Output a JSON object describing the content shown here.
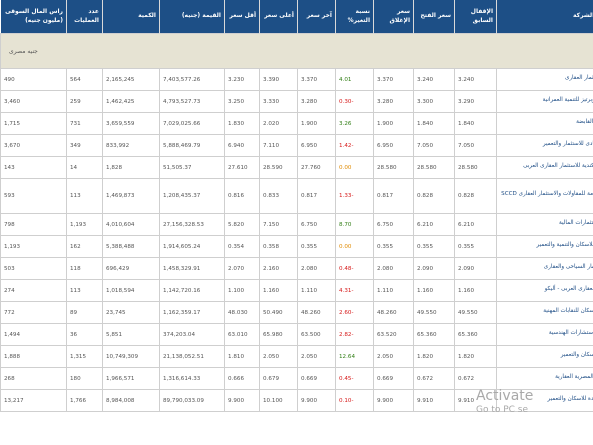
{
  "headers": {
    "name": "اسم الشركة",
    "prev": "الإقفال السابق",
    "close": "سعر الفتح",
    "closing": "سعر الإغلاق",
    "change": "نسبة التغير%",
    "last": "آخر سعر",
    "high": "أعلى سعر",
    "low": "أقل سعر",
    "value": "القيمة (جنيه)",
    "qty": "الكمية",
    "ops": "عدد العمليات",
    "cap": "راس المال السوقى (مليون جنيه)"
  },
  "section": "جنيه مصرى",
  "rows": [
    {
      "name": "تنمية للاستثمار العقارى",
      "prev": "3.240",
      "close": "3.240",
      "closing": "3.370",
      "change": "4.01",
      "dir": "pos",
      "last": "3.370",
      "high": "3.390",
      "low": "3.230",
      "value": "7,403,577.26",
      "qty": "2,165,245",
      "ops": "564",
      "cap": "490"
    },
    {
      "name": "بايونيرز بروبرتيز للتنمية العمرانية",
      "prev": "3.290",
      "close": "3.300",
      "closing": "3.280",
      "change": "-0.30",
      "dir": "neg",
      "last": "3.280",
      "high": "3.330",
      "low": "3.250",
      "value": "4,793,527.73",
      "qty": "1,462,425",
      "ops": "259",
      "cap": "3,460"
    },
    {
      "name": "ايه كابيتال القابضة",
      "prev": "1.840",
      "close": "1.840",
      "closing": "1.900",
      "change": "3.26",
      "dir": "pos",
      "last": "1.900",
      "high": "2.020",
      "low": "1.830",
      "value": "7,029,025.66",
      "qty": "3,659,559",
      "ops": "731",
      "cap": "1,715"
    },
    {
      "name": "زهراء المعادى للاستثمار والتعمير",
      "prev": "7.050",
      "close": "7.050",
      "closing": "6.950",
      "change": "-1.42",
      "dir": "neg",
      "last": "6.950",
      "high": "7.110",
      "low": "6.940",
      "value": "5,888,469.79",
      "qty": "833,992",
      "ops": "349",
      "cap": "3,670"
    },
    {
      "name": "الخليجية الكندية للاستثمار العقارى العربى",
      "prev": "28.580",
      "close": "28.580",
      "closing": "28.580",
      "change": "0.00",
      "dir": "zero",
      "last": "27.760",
      "high": "28.590",
      "low": "27.610",
      "value": "51,505.37",
      "qty": "1,828",
      "ops": "14",
      "cap": "143"
    },
    {
      "name": "الصعيد العامة للمقاولات والاستثمار العقارى SCCD",
      "prev": "0.828",
      "close": "0.828",
      "closing": "0.817",
      "change": "-1.33",
      "dir": "neg",
      "last": "0.817",
      "high": "0.833",
      "low": "0.816",
      "value": "1,208,435.37",
      "qty": "1,469,873",
      "ops": "113",
      "cap": "593",
      "tall": true
    },
    {
      "name": "ريمان للاستثمارات المالية",
      "prev": "6.210",
      "close": "6.210",
      "closing": "6.750",
      "change": "8.70",
      "dir": "pos",
      "last": "6.750",
      "high": "7.150",
      "low": "5.820",
      "value": "27,156,328.53",
      "qty": "4,010,604",
      "ops": "1,193",
      "cap": "798"
    },
    {
      "name": "المصريين للاسكان والتنمية والتعمير",
      "prev": "0.355",
      "close": "0.355",
      "closing": "0.355",
      "change": "0.00",
      "dir": "zero",
      "last": "0.355",
      "high": "0.358",
      "low": "0.354",
      "value": "1,914,605.24",
      "qty": "5,388,488",
      "ops": "162",
      "cap": "1,193"
    },
    {
      "name": "مينا للاستثمار السياحى والعقارى",
      "prev": "2.090",
      "close": "2.090",
      "closing": "2.080",
      "change": "-0.48",
      "dir": "neg",
      "last": "2.080",
      "high": "2.160",
      "low": "2.070",
      "value": "1,458,329.91",
      "qty": "696,429",
      "ops": "118",
      "cap": "503"
    },
    {
      "name": "الاستثمار العقارى العربى - أليكو",
      "prev": "1.160",
      "close": "1.160",
      "closing": "1.110",
      "change": "-4.31",
      "dir": "neg",
      "last": "1.110",
      "high": "1.160",
      "low": "1.100",
      "value": "1,142,720.16",
      "qty": "1,018,594",
      "ops": "113",
      "cap": "274"
    },
    {
      "name": "الوطنية للاسكان للنقابات المهنية",
      "prev": "49.550",
      "close": "49.550",
      "closing": "48.260",
      "change": "-2.60",
      "dir": "neg",
      "last": "48.260",
      "high": "50.490",
      "low": "48.030",
      "value": "1,162,359.17",
      "qty": "23,745",
      "ops": "89",
      "cap": "772"
    },
    {
      "name": "التعمير والاستشارات الهندسية",
      "prev": "65.360",
      "close": "65.360",
      "closing": "63.520",
      "change": "-2.82",
      "dir": "neg",
      "last": "63.500",
      "high": "65.980",
      "low": "63.010",
      "value": "374,203.04",
      "qty": "5,851",
      "ops": "36",
      "cap": "1,494"
    },
    {
      "name": "القاهرة للاسكان والتعمير",
      "prev": "1.820",
      "close": "1.820",
      "closing": "2.050",
      "change": "12.64",
      "dir": "pos",
      "last": "2.050",
      "high": "2.050",
      "low": "1.810",
      "value": "21,138,052.51",
      "qty": "10,749,309",
      "ops": "1,315",
      "cap": "1,888"
    },
    {
      "name": "المجموعه المصرية العقارية",
      "prev": "0.672",
      "close": "0.672",
      "closing": "0.669",
      "change": "-0.45",
      "dir": "neg",
      "last": "0.669",
      "high": "0.679",
      "low": "0.666",
      "value": "1,316,614.33",
      "qty": "1,966,571",
      "ops": "180",
      "cap": "268"
    },
    {
      "name": "مصر الجديدة للاسكان والتعمير",
      "prev": "9.910",
      "close": "9.910",
      "closing": "9.900",
      "change": "-0.10",
      "dir": "neg",
      "last": "9.900",
      "high": "10.100",
      "low": "9.900",
      "value": "89,790,033.09",
      "qty": "8,984,008",
      "ops": "1,766",
      "cap": "13,217"
    }
  ],
  "watermark": {
    "line1": "Activate",
    "line2": "Go to PC se"
  }
}
